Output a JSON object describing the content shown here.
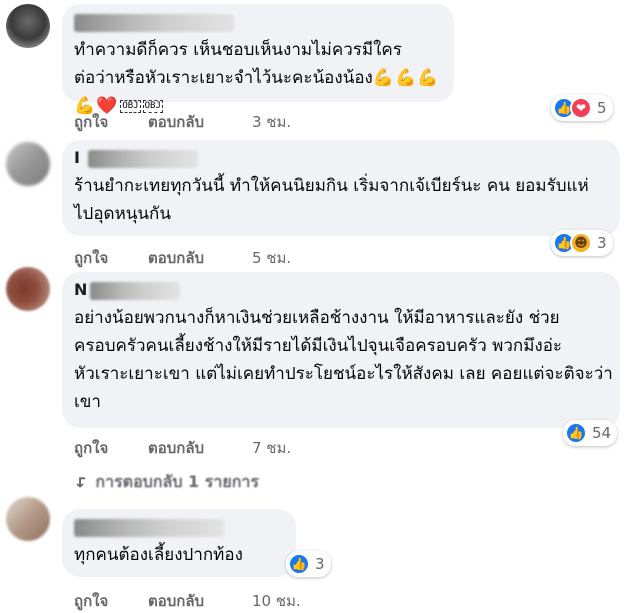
{
  "comments": [
    {
      "text": "ทำความดีก็ควร เห็นชอบเห็นงามไม่ควรมีใครต่อว่าหรือหัวเราะเยาะจำไว้นะคะน้องน้อง",
      "emojis": "💪💪💪💪❤️",
      "tail": "OBJ",
      "like_label": "ถูกใจ",
      "reply_label": "ตอบกลับ",
      "time": "3 ชม.",
      "reaction_count": "5"
    },
    {
      "author_initial": "I",
      "text": "ร้านยำกะเทยทุกวันนี้ ทำให้คนนิยมกิน เริ่มจากเจ้เบียร์นะ คน ยอมรับแห่ไปอุดหนุนกัน",
      "like_label": "ถูกใจ",
      "reply_label": "ตอบกลับ",
      "time": "5 ชม.",
      "reaction_count": "3"
    },
    {
      "author_initial": "N",
      "text": "อย่างน้อยพวกนางก็หาเงินช่วยเหลือช้างงาน ให้มีอาหารและยัง ช่วยครอบครัวคนเลี้ยงช้างให้มีรายได้มีเงินไปจุนเจือครอบครัว พวกมึงอ่ะหัวเราะเยาะเขา แต่ไม่เคยทำประโยชน์อะไรให้สังคม เลย คอยแต่จะติจะว่าเขา",
      "like_label": "ถูกใจ",
      "reply_label": "ตอบกลับ",
      "time": "7 ชม.",
      "reaction_count": "54",
      "replies_link": "การตอบกลับ 1 รายการ"
    },
    {
      "text": "ทุกคนต้องเลี้ยงปากท้อง",
      "like_label": "ถูกใจ",
      "reply_label": "ตอบกลับ",
      "time": "10 ชม.",
      "reaction_count": "3"
    }
  ],
  "colors": {
    "bubble": "#f0f2f5",
    "meta": "#65676b",
    "like_blue": "#1877f2",
    "love_red": "#f33e58",
    "haha_yellow": "#f7b125"
  },
  "icons": [
    "like-reaction-icon",
    "love-reaction-icon",
    "haha-reaction-icon",
    "reply-arrow-icon"
  ]
}
